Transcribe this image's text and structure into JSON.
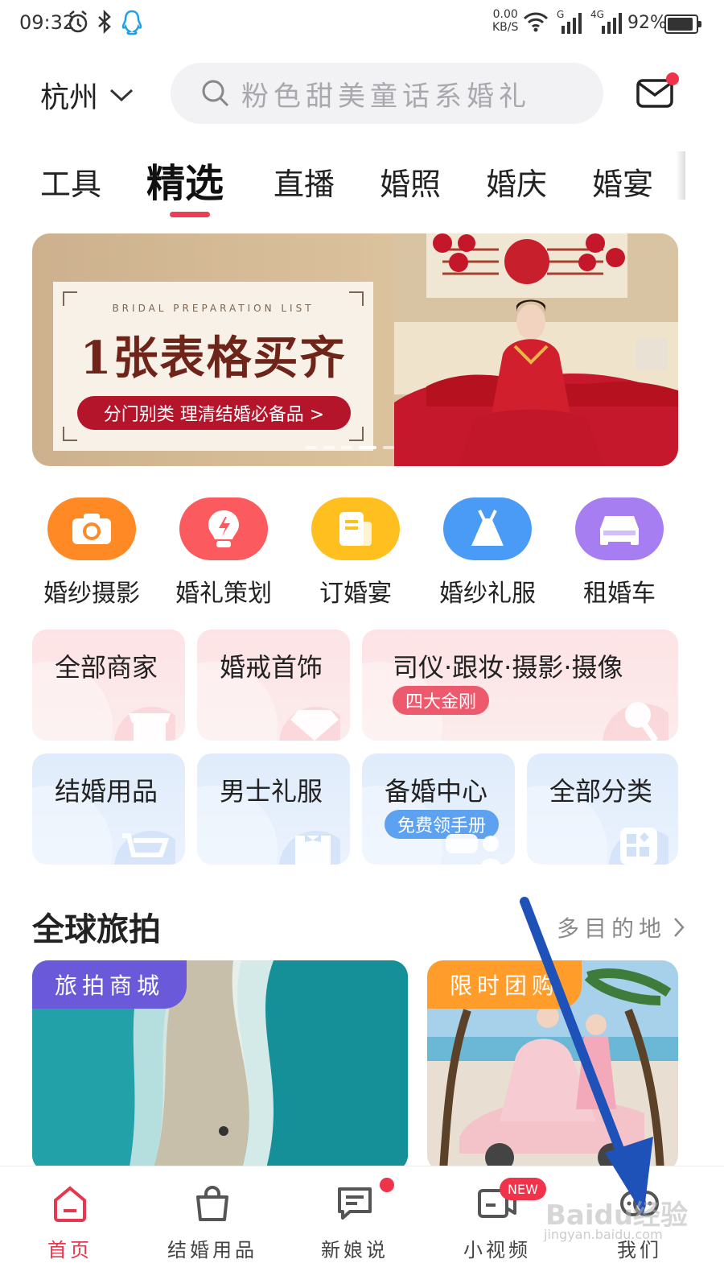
{
  "status_bar": {
    "time": "09:32",
    "net_speed_top": "0.00",
    "net_speed_bottom": "KB/S",
    "signal1": "G",
    "signal2": "4G",
    "battery_text": "92%",
    "battery_level": 0.92
  },
  "header": {
    "city": "杭州",
    "search_placeholder": "粉色甜美童话系婚礼"
  },
  "tabs": [
    "工具",
    "精选",
    "直播",
    "婚照",
    "婚庆",
    "婚宴"
  ],
  "active_tab_index": 1,
  "banner": {
    "subtitle_en": "BRIDAL PREPARATION LIST",
    "headline": "1张表格买齐",
    "pill_text": "分门别类  理清结婚必备品 >"
  },
  "categories": [
    {
      "label": "婚纱摄影",
      "color": "#ff8a25",
      "icon": "camera-icon"
    },
    {
      "label": "婚礼策划",
      "color": "#fb5a5e",
      "icon": "bulb-icon"
    },
    {
      "label": "订婚宴",
      "color": "#ffbf1f",
      "icon": "menu-icon"
    },
    {
      "label": "婚纱礼服",
      "color": "#4a9bf5",
      "icon": "dress-icon"
    },
    {
      "label": "租婚车",
      "color": "#a67ef2",
      "icon": "car-icon"
    }
  ],
  "grid": {
    "all_merchants": "全部商家",
    "rings": "婚戒首饰",
    "four_services": "司仪·跟妆·摄影·摄像",
    "four_badge": "四大金刚",
    "supplies": "结婚用品",
    "menswear": "男士礼服",
    "prep_center": "备婚中心",
    "prep_badge": "免费领手册",
    "all_categories": "全部分类"
  },
  "section": {
    "title": "全球旅拍",
    "more": "多目的地"
  },
  "travel_cards": [
    {
      "tag": "旅拍商城"
    },
    {
      "tag": "限时团购"
    }
  ],
  "bottom_nav": [
    {
      "label": "首页",
      "icon": "home-icon"
    },
    {
      "label": "结婚用品",
      "icon": "bag-icon"
    },
    {
      "label": "新娘说",
      "icon": "chat-icon"
    },
    {
      "label": "小视频",
      "icon": "video-icon"
    },
    {
      "label": "我们",
      "icon": "couple-icon"
    }
  ],
  "new_badge": "NEW",
  "watermark": {
    "brand": "Baidu经验",
    "url": "jingyan.baidu.com"
  },
  "colors": {
    "accent": "#e8364c",
    "annotation_arrow": "#1f52b8"
  }
}
